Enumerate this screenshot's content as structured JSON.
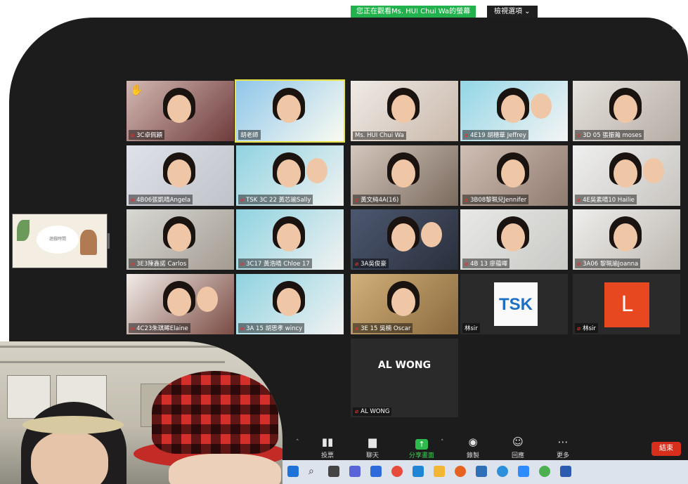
{
  "banner": {
    "share_notice": "您正在觀看Ms. HUI Chui Wa的螢幕",
    "view_options": "檢視選項 ⌄"
  },
  "participants": [
    {
      "name": "3C卓佩穎",
      "muted": true
    },
    {
      "name": "胡老師",
      "muted": false
    },
    {
      "name": "Ms. HUI Chui Wa",
      "muted": false
    },
    {
      "name": "4E19 胡穗華 Jeffrey",
      "muted": true
    },
    {
      "name": "3D 05 張振瀚 moses",
      "muted": true
    },
    {
      "name": "4B06張凱晴Angela",
      "muted": true
    },
    {
      "name": "TSK 3C 22 黃芯瑜Sally",
      "muted": true
    },
    {
      "name": "黃文純4A(16)",
      "muted": true
    },
    {
      "name": "3B08黎珮兒Jennifer",
      "muted": true
    },
    {
      "name": "4E吳素晴10 Hailie",
      "muted": true
    },
    {
      "name": "3E3陳鑫諾 Carlos",
      "muted": true
    },
    {
      "name": "3C17 黃浩晴 Chloe 17",
      "muted": true
    },
    {
      "name": "3A吳俊豪",
      "muted": true
    },
    {
      "name": "4B 13 廖蘊暉",
      "muted": true
    },
    {
      "name": "3A06 黎珮瑜Joanna",
      "muted": true
    },
    {
      "name": "4C23朱琪晞Elaine",
      "muted": true
    },
    {
      "name": "3A 15 胡思孝 wincy",
      "muted": true
    },
    {
      "name": "3E 15 吳楠 Oscar",
      "muted": true
    },
    {
      "name": "林sir",
      "muted": false
    },
    {
      "name": "林sir",
      "muted": true
    },
    {
      "name": "AL WONG",
      "muted": true
    }
  ],
  "avatars": {
    "al_wong_display": "AL WONG",
    "tsk_logo": "TSK",
    "letter": "L"
  },
  "slide": {
    "text": "遊戲時間"
  },
  "toolbar": {
    "poll": "投票",
    "chat": "聊天",
    "share": "分享畫面",
    "record": "錄製",
    "reactions": "回應",
    "more": "更多",
    "end": "結束"
  },
  "icons": {
    "mic_muted": "🎤",
    "raise_hand": "✋",
    "poll": "chart-icon",
    "chat": "chat-bubble-icon",
    "share": "upload-arrow-icon",
    "record": "record-dot-icon",
    "reactions": "smile-plus-icon",
    "more": "ellipsis-icon"
  },
  "colors": {
    "share_green": "#23b14d",
    "end_red": "#d82e1c",
    "active_speaker": "#e9e34a"
  }
}
